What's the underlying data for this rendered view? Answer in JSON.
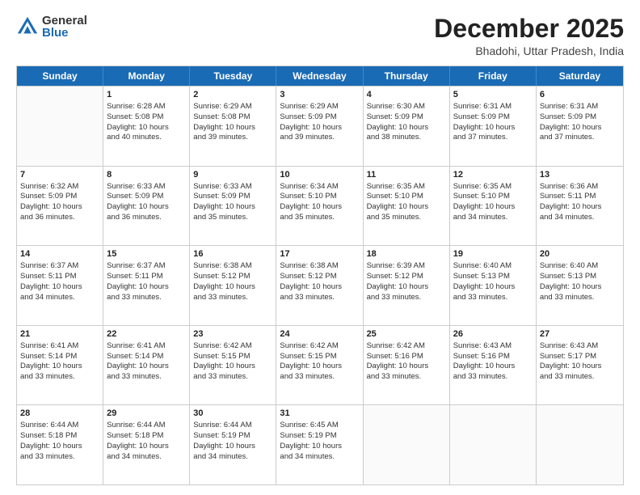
{
  "logo": {
    "general": "General",
    "blue": "Blue"
  },
  "title": "December 2025",
  "subtitle": "Bhadohi, Uttar Pradesh, India",
  "weekdays": [
    "Sunday",
    "Monday",
    "Tuesday",
    "Wednesday",
    "Thursday",
    "Friday",
    "Saturday"
  ],
  "rows": [
    [
      {
        "day": "",
        "lines": []
      },
      {
        "day": "1",
        "lines": [
          "Sunrise: 6:28 AM",
          "Sunset: 5:08 PM",
          "Daylight: 10 hours",
          "and 40 minutes."
        ]
      },
      {
        "day": "2",
        "lines": [
          "Sunrise: 6:29 AM",
          "Sunset: 5:08 PM",
          "Daylight: 10 hours",
          "and 39 minutes."
        ]
      },
      {
        "day": "3",
        "lines": [
          "Sunrise: 6:29 AM",
          "Sunset: 5:09 PM",
          "Daylight: 10 hours",
          "and 39 minutes."
        ]
      },
      {
        "day": "4",
        "lines": [
          "Sunrise: 6:30 AM",
          "Sunset: 5:09 PM",
          "Daylight: 10 hours",
          "and 38 minutes."
        ]
      },
      {
        "day": "5",
        "lines": [
          "Sunrise: 6:31 AM",
          "Sunset: 5:09 PM",
          "Daylight: 10 hours",
          "and 37 minutes."
        ]
      },
      {
        "day": "6",
        "lines": [
          "Sunrise: 6:31 AM",
          "Sunset: 5:09 PM",
          "Daylight: 10 hours",
          "and 37 minutes."
        ]
      }
    ],
    [
      {
        "day": "7",
        "lines": [
          "Sunrise: 6:32 AM",
          "Sunset: 5:09 PM",
          "Daylight: 10 hours",
          "and 36 minutes."
        ]
      },
      {
        "day": "8",
        "lines": [
          "Sunrise: 6:33 AM",
          "Sunset: 5:09 PM",
          "Daylight: 10 hours",
          "and 36 minutes."
        ]
      },
      {
        "day": "9",
        "lines": [
          "Sunrise: 6:33 AM",
          "Sunset: 5:09 PM",
          "Daylight: 10 hours",
          "and 35 minutes."
        ]
      },
      {
        "day": "10",
        "lines": [
          "Sunrise: 6:34 AM",
          "Sunset: 5:10 PM",
          "Daylight: 10 hours",
          "and 35 minutes."
        ]
      },
      {
        "day": "11",
        "lines": [
          "Sunrise: 6:35 AM",
          "Sunset: 5:10 PM",
          "Daylight: 10 hours",
          "and 35 minutes."
        ]
      },
      {
        "day": "12",
        "lines": [
          "Sunrise: 6:35 AM",
          "Sunset: 5:10 PM",
          "Daylight: 10 hours",
          "and 34 minutes."
        ]
      },
      {
        "day": "13",
        "lines": [
          "Sunrise: 6:36 AM",
          "Sunset: 5:11 PM",
          "Daylight: 10 hours",
          "and 34 minutes."
        ]
      }
    ],
    [
      {
        "day": "14",
        "lines": [
          "Sunrise: 6:37 AM",
          "Sunset: 5:11 PM",
          "Daylight: 10 hours",
          "and 34 minutes."
        ]
      },
      {
        "day": "15",
        "lines": [
          "Sunrise: 6:37 AM",
          "Sunset: 5:11 PM",
          "Daylight: 10 hours",
          "and 33 minutes."
        ]
      },
      {
        "day": "16",
        "lines": [
          "Sunrise: 6:38 AM",
          "Sunset: 5:12 PM",
          "Daylight: 10 hours",
          "and 33 minutes."
        ]
      },
      {
        "day": "17",
        "lines": [
          "Sunrise: 6:38 AM",
          "Sunset: 5:12 PM",
          "Daylight: 10 hours",
          "and 33 minutes."
        ]
      },
      {
        "day": "18",
        "lines": [
          "Sunrise: 6:39 AM",
          "Sunset: 5:12 PM",
          "Daylight: 10 hours",
          "and 33 minutes."
        ]
      },
      {
        "day": "19",
        "lines": [
          "Sunrise: 6:40 AM",
          "Sunset: 5:13 PM",
          "Daylight: 10 hours",
          "and 33 minutes."
        ]
      },
      {
        "day": "20",
        "lines": [
          "Sunrise: 6:40 AM",
          "Sunset: 5:13 PM",
          "Daylight: 10 hours",
          "and 33 minutes."
        ]
      }
    ],
    [
      {
        "day": "21",
        "lines": [
          "Sunrise: 6:41 AM",
          "Sunset: 5:14 PM",
          "Daylight: 10 hours",
          "and 33 minutes."
        ]
      },
      {
        "day": "22",
        "lines": [
          "Sunrise: 6:41 AM",
          "Sunset: 5:14 PM",
          "Daylight: 10 hours",
          "and 33 minutes."
        ]
      },
      {
        "day": "23",
        "lines": [
          "Sunrise: 6:42 AM",
          "Sunset: 5:15 PM",
          "Daylight: 10 hours",
          "and 33 minutes."
        ]
      },
      {
        "day": "24",
        "lines": [
          "Sunrise: 6:42 AM",
          "Sunset: 5:15 PM",
          "Daylight: 10 hours",
          "and 33 minutes."
        ]
      },
      {
        "day": "25",
        "lines": [
          "Sunrise: 6:42 AM",
          "Sunset: 5:16 PM",
          "Daylight: 10 hours",
          "and 33 minutes."
        ]
      },
      {
        "day": "26",
        "lines": [
          "Sunrise: 6:43 AM",
          "Sunset: 5:16 PM",
          "Daylight: 10 hours",
          "and 33 minutes."
        ]
      },
      {
        "day": "27",
        "lines": [
          "Sunrise: 6:43 AM",
          "Sunset: 5:17 PM",
          "Daylight: 10 hours",
          "and 33 minutes."
        ]
      }
    ],
    [
      {
        "day": "28",
        "lines": [
          "Sunrise: 6:44 AM",
          "Sunset: 5:18 PM",
          "Daylight: 10 hours",
          "and 33 minutes."
        ]
      },
      {
        "day": "29",
        "lines": [
          "Sunrise: 6:44 AM",
          "Sunset: 5:18 PM",
          "Daylight: 10 hours",
          "and 34 minutes."
        ]
      },
      {
        "day": "30",
        "lines": [
          "Sunrise: 6:44 AM",
          "Sunset: 5:19 PM",
          "Daylight: 10 hours",
          "and 34 minutes."
        ]
      },
      {
        "day": "31",
        "lines": [
          "Sunrise: 6:45 AM",
          "Sunset: 5:19 PM",
          "Daylight: 10 hours",
          "and 34 minutes."
        ]
      },
      {
        "day": "",
        "lines": []
      },
      {
        "day": "",
        "lines": []
      },
      {
        "day": "",
        "lines": []
      }
    ]
  ]
}
